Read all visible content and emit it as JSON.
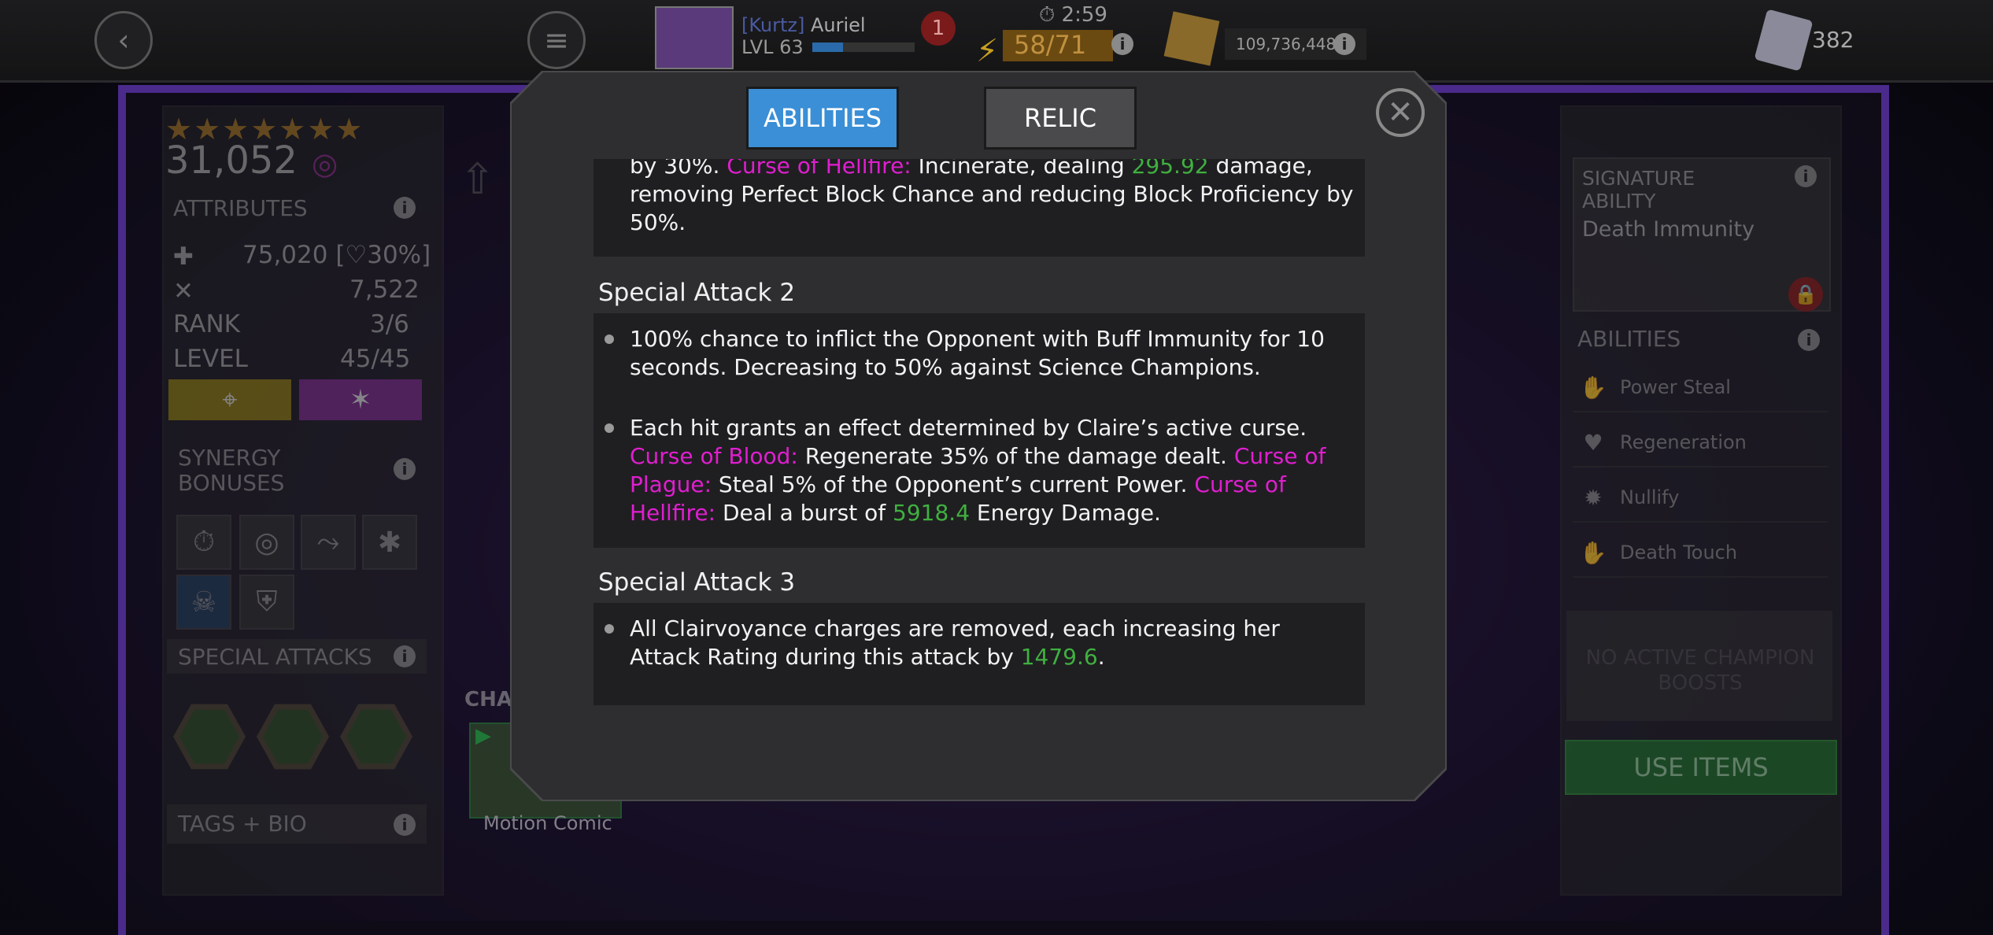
{
  "topbar": {
    "player_tag": "[Kurtz]",
    "player_name": "Auriel",
    "player_level": "LVL 63",
    "notification_count": "1",
    "timer": "2:59",
    "energy": "58/71",
    "gold": "109,736,448",
    "units": "382"
  },
  "champion": {
    "stars": "★★★★★★★",
    "rating": "31,052"
  },
  "attributes": {
    "title": "ATTRIBUTES",
    "health": "75,020",
    "health_pct": "30%",
    "attack": "7,522",
    "rank_label": "RANK",
    "rank_value": "3/6",
    "level_label": "LEVEL",
    "level_value": "45/45"
  },
  "synergy": {
    "title": "SYNERGY BONUSES"
  },
  "special_attacks": {
    "title": "SPECIAL ATTACKS"
  },
  "tags_bio": {
    "title": "TAGS + BIO"
  },
  "motion_comic": {
    "label": "Motion Comic",
    "header_partial": "CHA"
  },
  "signature": {
    "title": "SIGNATURE ABILITY",
    "ability": "Death Immunity"
  },
  "abilities_panel": {
    "title": "ABILITIES",
    "items": [
      "Power Steal",
      "Regeneration",
      "Nullify",
      "Death Touch"
    ],
    "no_boosts": "NO ACTIVE CHAMPION BOOSTS",
    "use_items": "USE ITEMS"
  },
  "modal": {
    "tabs": [
      "ABILITIES",
      "RELIC"
    ],
    "top_block": {
      "p1": "by 30%. ",
      "p2": "Curse of Hellfire:",
      "p3": " Incinerate, dealing ",
      "p4": "295.92",
      "p5": " damage, removing Perfect Block Chance and reducing Block Proficiency by 50%."
    },
    "sa2": {
      "title": "Special Attack 2",
      "bullet1": "100% chance to inflict the Opponent with Buff Immunity for 10 seconds. Decreasing to 50% against Science Champions.",
      "b2_p1": "Each hit grants an effect determined by Claire’s active curse. ",
      "b2_p2": "Curse of Blood:",
      "b2_p3": " Regenerate 35% of the damage dealt. ",
      "b2_p4": "Curse of Plague:",
      "b2_p5": " Steal 5% of the Opponent’s current Power. ",
      "b2_p6": "Curse of Hellfire:",
      "b2_p7": " Deal a burst of ",
      "b2_p8": "5918.4",
      "b2_p9": " Energy Damage."
    },
    "sa3": {
      "title": "Special Attack 3",
      "b1_p1": "All Clairvoyance charges are removed, each increasing her Attack Rating during this attack by ",
      "b1_p2": "1479.6",
      "b1_p3": "."
    }
  },
  "colors": {
    "tab_active": "#3a8fd6",
    "curse_pink": "#e01ed0",
    "value_green": "#40b040",
    "use_items_green": "#1e6e2a"
  }
}
